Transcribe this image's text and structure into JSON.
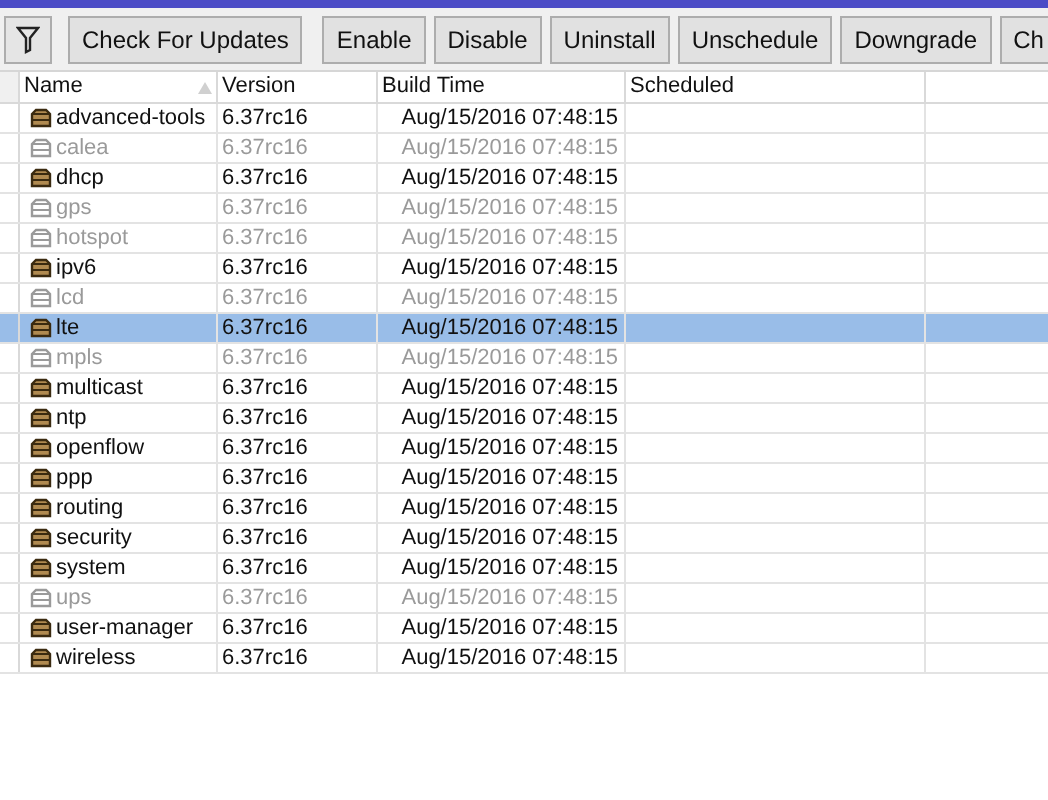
{
  "toolbar": {
    "buttons": [
      "Check For Updates",
      "Enable",
      "Disable",
      "Uninstall",
      "Unschedule",
      "Downgrade",
      "Ch"
    ]
  },
  "table": {
    "columns": [
      "Name",
      "Version",
      "Build Time",
      "Scheduled"
    ],
    "rows": [
      {
        "name": "advanced-tools",
        "version": "6.37rc16",
        "build_time": "Aug/15/2016 07:48:15",
        "disabled": false,
        "selected": false
      },
      {
        "name": "calea",
        "version": "6.37rc16",
        "build_time": "Aug/15/2016 07:48:15",
        "disabled": true,
        "selected": false
      },
      {
        "name": "dhcp",
        "version": "6.37rc16",
        "build_time": "Aug/15/2016 07:48:15",
        "disabled": false,
        "selected": false
      },
      {
        "name": "gps",
        "version": "6.37rc16",
        "build_time": "Aug/15/2016 07:48:15",
        "disabled": true,
        "selected": false
      },
      {
        "name": "hotspot",
        "version": "6.37rc16",
        "build_time": "Aug/15/2016 07:48:15",
        "disabled": true,
        "selected": false
      },
      {
        "name": "ipv6",
        "version": "6.37rc16",
        "build_time": "Aug/15/2016 07:48:15",
        "disabled": false,
        "selected": false
      },
      {
        "name": "lcd",
        "version": "6.37rc16",
        "build_time": "Aug/15/2016 07:48:15",
        "disabled": true,
        "selected": false
      },
      {
        "name": "lte",
        "version": "6.37rc16",
        "build_time": "Aug/15/2016 07:48:15",
        "disabled": false,
        "selected": true
      },
      {
        "name": "mpls",
        "version": "6.37rc16",
        "build_time": "Aug/15/2016 07:48:15",
        "disabled": true,
        "selected": false
      },
      {
        "name": "multicast",
        "version": "6.37rc16",
        "build_time": "Aug/15/2016 07:48:15",
        "disabled": false,
        "selected": false
      },
      {
        "name": "ntp",
        "version": "6.37rc16",
        "build_time": "Aug/15/2016 07:48:15",
        "disabled": false,
        "selected": false
      },
      {
        "name": "openflow",
        "version": "6.37rc16",
        "build_time": "Aug/15/2016 07:48:15",
        "disabled": false,
        "selected": false
      },
      {
        "name": "ppp",
        "version": "6.37rc16",
        "build_time": "Aug/15/2016 07:48:15",
        "disabled": false,
        "selected": false
      },
      {
        "name": "routing",
        "version": "6.37rc16",
        "build_time": "Aug/15/2016 07:48:15",
        "disabled": false,
        "selected": false
      },
      {
        "name": "security",
        "version": "6.37rc16",
        "build_time": "Aug/15/2016 07:48:15",
        "disabled": false,
        "selected": false
      },
      {
        "name": "system",
        "version": "6.37rc16",
        "build_time": "Aug/15/2016 07:48:15",
        "disabled": false,
        "selected": false
      },
      {
        "name": "ups",
        "version": "6.37rc16",
        "build_time": "Aug/15/2016 07:48:15",
        "disabled": true,
        "selected": false
      },
      {
        "name": "user-manager",
        "version": "6.37rc16",
        "build_time": "Aug/15/2016 07:48:15",
        "disabled": false,
        "selected": false
      },
      {
        "name": "wireless",
        "version": "6.37rc16",
        "build_time": "Aug/15/2016 07:48:15",
        "disabled": false,
        "selected": false
      }
    ]
  }
}
